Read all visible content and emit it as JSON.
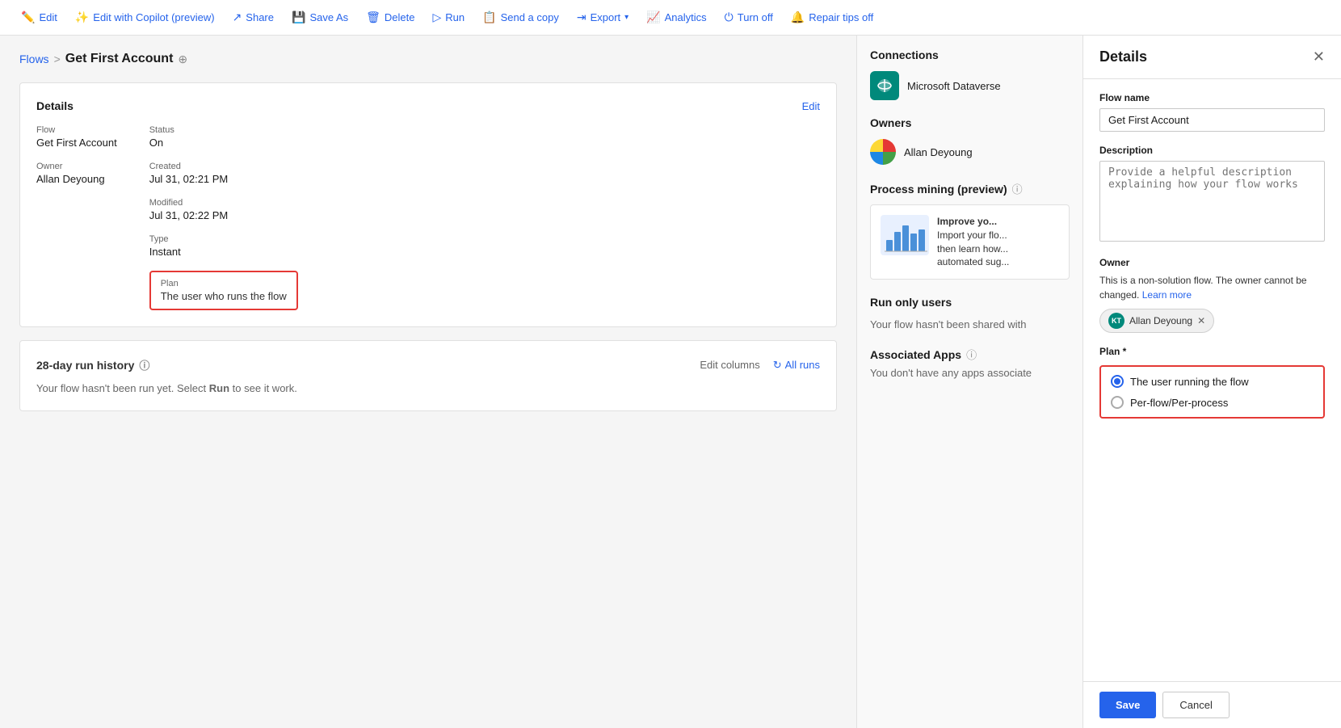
{
  "toolbar": {
    "edit_label": "Edit",
    "edit_copilot_label": "Edit with Copilot (preview)",
    "share_label": "Share",
    "save_as_label": "Save As",
    "delete_label": "Delete",
    "run_label": "Run",
    "send_copy_label": "Send a copy",
    "export_label": "Export",
    "analytics_label": "Analytics",
    "turn_off_label": "Turn off",
    "repair_tips_label": "Repair tips off"
  },
  "breadcrumb": {
    "flows_label": "Flows",
    "separator": ">",
    "current_flow": "Get First Account"
  },
  "details_card": {
    "title": "Details",
    "edit_label": "Edit",
    "flow_label": "Flow",
    "flow_value": "Get First Account",
    "owner_label": "Owner",
    "owner_value": "Allan Deyoung",
    "status_label": "Status",
    "status_value": "On",
    "created_label": "Created",
    "created_value": "Jul 31, 02:21 PM",
    "modified_label": "Modified",
    "modified_value": "Jul 31, 02:22 PM",
    "type_label": "Type",
    "type_value": "Instant",
    "plan_label": "Plan",
    "plan_value": "The user who runs the flow"
  },
  "run_history": {
    "title": "28-day run history",
    "edit_columns_label": "Edit columns",
    "all_runs_label": "All runs",
    "empty_message": "Your flow hasn't been run yet. Select",
    "run_keyword": "Run",
    "empty_message_end": "to see it work."
  },
  "right_panel": {
    "connections_title": "Connections",
    "connection_name": "Microsoft Dataverse",
    "owners_title": "Owners",
    "owner_name": "Allan Deyoung",
    "process_mining_title": "Process mining (preview)",
    "process_mining_text": "Improve yo... Import your flo... then learn how... automated sug...",
    "run_only_title": "Run only users",
    "run_only_empty": "Your flow hasn't been shared with",
    "associated_apps_title": "Associated Apps",
    "associated_apps_empty": "You don't have any apps associate"
  },
  "details_panel": {
    "title": "Details",
    "flow_name_label": "Flow name",
    "flow_name_value": "Get First Account",
    "description_label": "Description",
    "description_placeholder": "Provide a helpful description explaining how your flow works",
    "owner_label": "Owner",
    "owner_description": "This is a non-solution flow. The owner cannot be changed.",
    "owner_learn_more": "Learn more",
    "owner_tag_name": "Allan Deyoung",
    "owner_tag_initials": "KT",
    "plan_label": "Plan *",
    "plan_option1": "The user running the flow",
    "plan_option2": "Per-flow/Per-process",
    "save_label": "Save",
    "cancel_label": "Cancel"
  }
}
